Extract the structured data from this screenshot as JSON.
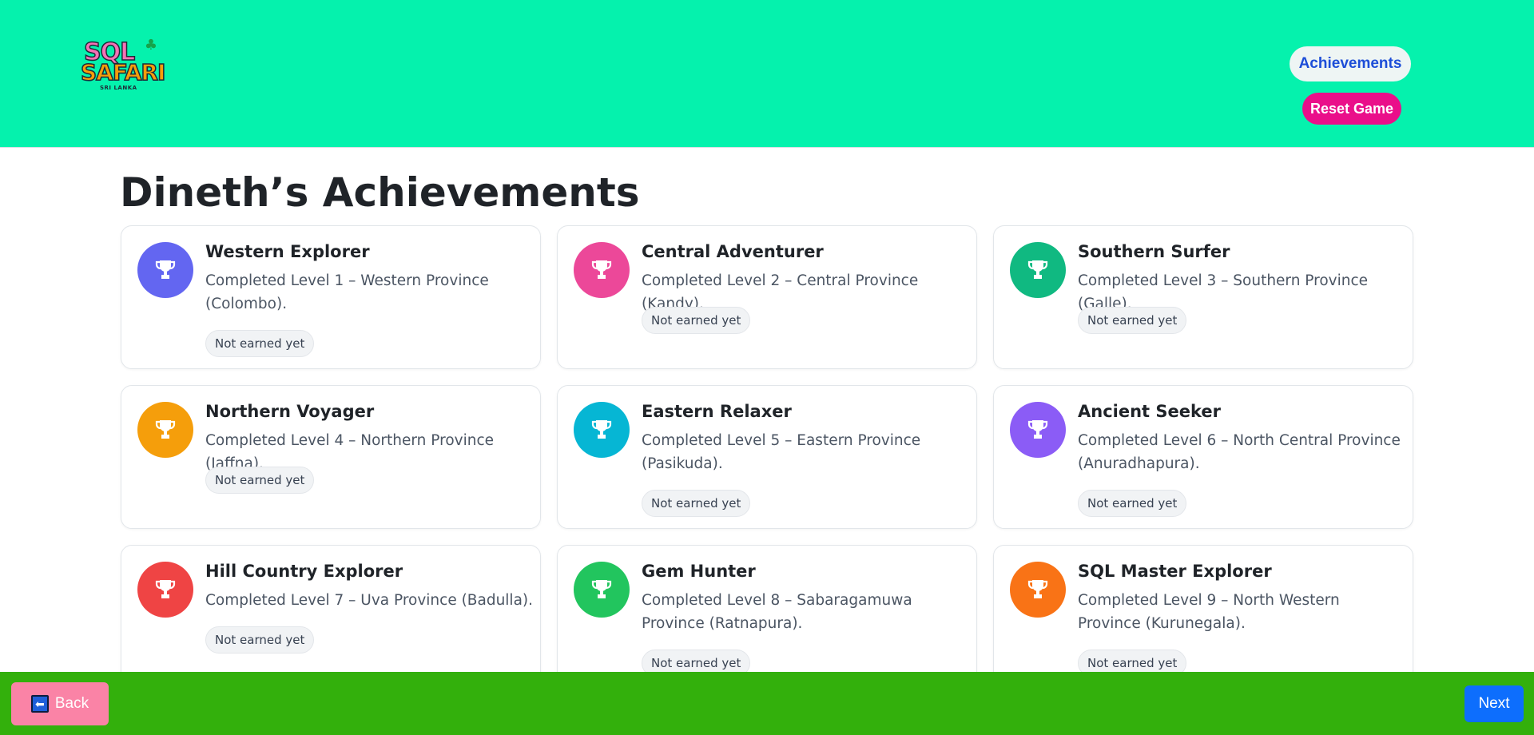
{
  "header": {
    "logo": {
      "line1": "SQL",
      "line2": "SAFARI",
      "line3": "SRI LANKA"
    },
    "achievements_label": "Achievements",
    "reset_label": "Reset Game",
    "colors": {
      "background": "#05f2ad",
      "achievements_text": "#1d4ed8",
      "reset_bg": "#ea0f8a"
    }
  },
  "main": {
    "title": "Dineth’s Achievements",
    "achievements": [
      {
        "title": "Western Explorer",
        "description": "Completed Level 1 – Western Province (Colombo).",
        "status": "Not earned yet",
        "color": "#6366f1",
        "icon": "trophy-icon"
      },
      {
        "title": "Central Adventurer",
        "description": "Completed Level 2 – Central Province (Kandy).",
        "status": "Not earned yet",
        "color": "#ec4899",
        "icon": "trophy-icon"
      },
      {
        "title": "Southern Surfer",
        "description": "Completed Level 3 – Southern Province (Galle).",
        "status": "Not earned yet",
        "color": "#10b981",
        "icon": "trophy-icon"
      },
      {
        "title": "Northern Voyager",
        "description": "Completed Level 4 – Northern Province (Jaffna).",
        "status": "Not earned yet",
        "color": "#f59e0b",
        "icon": "trophy-icon"
      },
      {
        "title": "Eastern Relaxer",
        "description": "Completed Level 5 – Eastern Province (Pasikuda).",
        "status": "Not earned yet",
        "color": "#06b6d4",
        "icon": "trophy-icon"
      },
      {
        "title": "Ancient Seeker",
        "description": "Completed Level 6 – North Central Province (Anuradhapura).",
        "status": "Not earned yet",
        "color": "#8b5cf6",
        "icon": "trophy-icon"
      },
      {
        "title": "Hill Country Explorer",
        "description": "Completed Level 7 – Uva Province (Badulla).",
        "status": "Not earned yet",
        "color": "#ef4444",
        "icon": "trophy-icon"
      },
      {
        "title": "Gem Hunter",
        "description": "Completed Level 8 – Sabaragamuwa Province (Ratnapura).",
        "status": "Not earned yet",
        "color": "#22c55e",
        "icon": "trophy-icon"
      },
      {
        "title": "SQL Master Explorer",
        "description": "Completed Level 9 – North Western Province (Kurunegala).",
        "status": "Not earned yet",
        "color": "#f97316",
        "icon": "trophy-icon"
      }
    ]
  },
  "footer": {
    "back_label": "Back",
    "back_icon": "back-arrow-icon",
    "next_label": "Next",
    "colors": {
      "background": "#33b00c",
      "back_bg": "#fa83a6",
      "next_bg": "#0d6efd"
    }
  }
}
